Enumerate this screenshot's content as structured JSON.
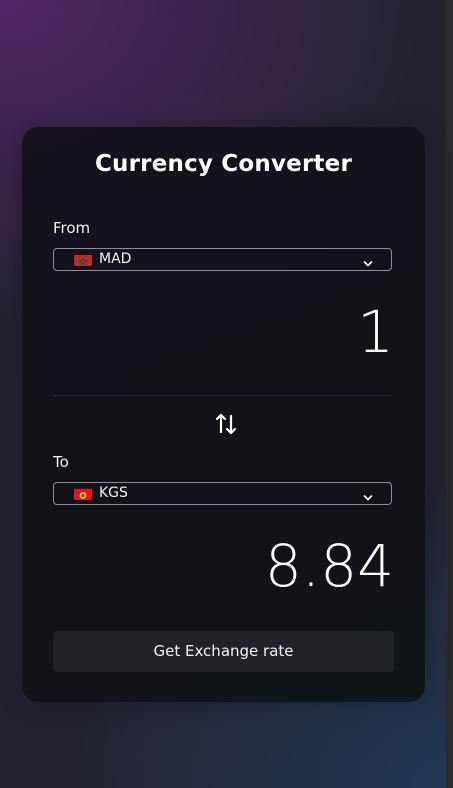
{
  "converter": {
    "title": "Currency Converter",
    "from": {
      "label": "From",
      "currency_code": "MAD",
      "flag_icon": "morocco-flag-icon",
      "amount": "1"
    },
    "to": {
      "label": "To",
      "currency_code": "KGS",
      "flag_icon": "kyrgyzstan-flag-icon",
      "amount": "8.84"
    },
    "swap_icon": "swap-arrows-icon",
    "button_label": "Get Exchange rate"
  },
  "colors": {
    "background_top_left": "#58266e",
    "background_bottom_right": "#223a58",
    "card_background": "#121218",
    "button_background": "#202228",
    "select_border": "#8d8d95"
  }
}
